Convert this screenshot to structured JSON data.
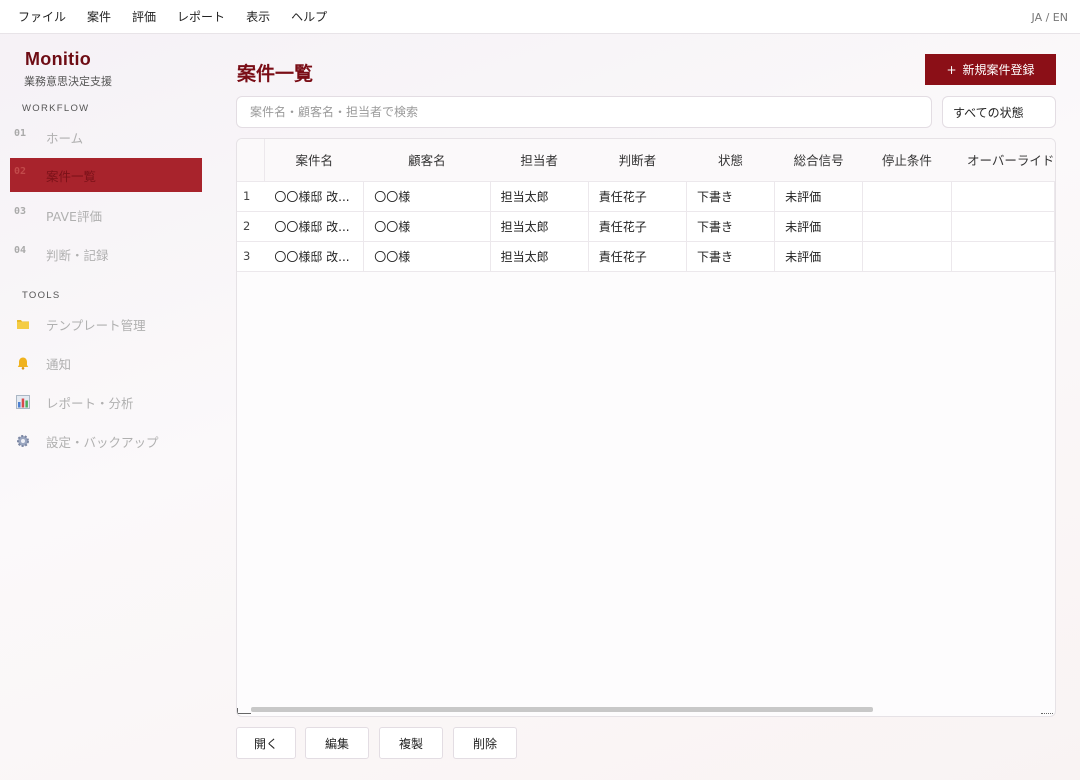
{
  "menu": {
    "items": [
      "ファイル",
      "案件",
      "評価",
      "レポート",
      "表示",
      "ヘルプ"
    ],
    "lang": "JA / EN"
  },
  "sidebar": {
    "brand": "Monitio",
    "subtitle": "業務意思決定支援",
    "workflow_title": "WORKFLOW",
    "workflow": [
      {
        "num": "01",
        "label": "ホーム"
      },
      {
        "num": "02",
        "label": "案件一覧",
        "active": true
      },
      {
        "num": "03",
        "label": "PAVE評価"
      },
      {
        "num": "04",
        "label": "判断・記録"
      }
    ],
    "tools_title": "TOOLS",
    "tools": [
      {
        "icon": "folder-icon",
        "label": "テンプレート管理"
      },
      {
        "icon": "bell-icon",
        "label": "通知"
      },
      {
        "icon": "bar-chart-icon",
        "label": "レポート・分析"
      },
      {
        "icon": "gear-icon",
        "label": "設定・バックアップ"
      }
    ]
  },
  "main": {
    "title": "案件一覧",
    "new_button": "新規案件登録",
    "new_button_icon": "+",
    "search_placeholder": "案件名・顧客名・担当者で検索",
    "status_filter": "すべての状態",
    "table": {
      "columns": [
        "案件名",
        "顧客名",
        "担当者",
        "判断者",
        "状態",
        "総合信号",
        "停止条件",
        "オーバーライド"
      ],
      "rows": [
        {
          "index": "1",
          "cells": [
            "〇〇様邸 改...",
            "〇〇様",
            "担当太郎",
            "責任花子",
            "下書き",
            "未評価",
            "",
            ""
          ]
        },
        {
          "index": "2",
          "cells": [
            "〇〇様邸 改...",
            "〇〇様",
            "担当太郎",
            "責任花子",
            "下書き",
            "未評価",
            "",
            ""
          ]
        },
        {
          "index": "3",
          "cells": [
            "〇〇様邸 改...",
            "〇〇様",
            "担当太郎",
            "責任花子",
            "下書き",
            "未評価",
            "",
            ""
          ]
        }
      ]
    },
    "actions": [
      "開く",
      "編集",
      "複製",
      "削除"
    ]
  },
  "colors": {
    "accent": "#8b0f17",
    "active_nav": "#a8232c",
    "title": "#7a0d16"
  }
}
